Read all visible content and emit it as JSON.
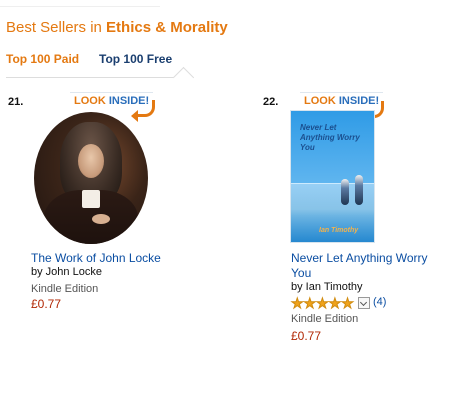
{
  "header": {
    "prefix": "Best Sellers in ",
    "category": "Ethics & Morality"
  },
  "tabs": [
    {
      "label": "Top 100 Paid",
      "active": true
    },
    {
      "label": "Top 100 Free",
      "active": false
    }
  ],
  "products": [
    {
      "rank": "21.",
      "look_inside": {
        "look": "LOOK",
        "inside": "INSIDE!"
      },
      "title_lines": [
        "The Work of John Locke"
      ],
      "by": "by John Locke",
      "format": "Kindle Edition",
      "price": "£0.77"
    },
    {
      "rank": "22.",
      "look_inside": {
        "look": "LOOK",
        "inside": "INSIDE!"
      },
      "cover_title": "Never Let Anything Worry You",
      "cover_author": "Ian Timothy",
      "title_lines": [
        "Never Let Anything Worry",
        "You"
      ],
      "by": "by Ian Timothy",
      "rating": {
        "stars": 5,
        "count_label": "(4)"
      },
      "format": "Kindle Edition",
      "price": "£0.77"
    }
  ],
  "colors": {
    "accent": "#e47911",
    "link": "#0b4ea2",
    "price": "#b12704",
    "star": "#f0a31b"
  },
  "icons": {
    "look_inside_arrow": "curved-arrow-icon",
    "star": "star-icon",
    "dropdown": "chevron-down-icon"
  }
}
